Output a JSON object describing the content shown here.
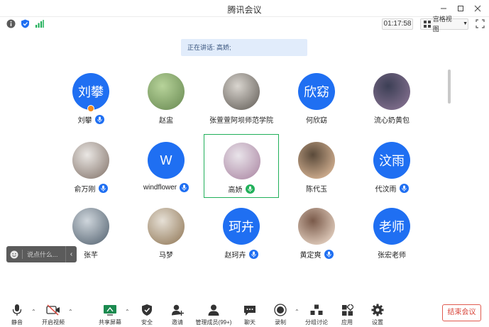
{
  "window": {
    "title": "腾讯会议"
  },
  "infobar": {
    "timer": "01:17:58",
    "view_mode": "宫格视图"
  },
  "speaking": {
    "text": "正在讲话: 高娇;"
  },
  "participants": [
    {
      "name": "刘攀",
      "avatar_text": "刘攀",
      "type": "text",
      "mic": "on",
      "host": true
    },
    {
      "name": "赵盅",
      "avatar_text": "",
      "type": "photo",
      "mic": "none",
      "host": false
    },
    {
      "name": "张萱萱阿坝师范学院",
      "avatar_text": "",
      "type": "photo",
      "mic": "none",
      "host": false
    },
    {
      "name": "何欣窈",
      "avatar_text": "欣窈",
      "type": "text",
      "mic": "none",
      "host": false
    },
    {
      "name": "流心奶黄包",
      "avatar_text": "",
      "type": "photo",
      "mic": "none",
      "host": false
    },
    {
      "name": "俞万刚",
      "avatar_text": "",
      "type": "photo",
      "mic": "on",
      "host": false
    },
    {
      "name": "windflower",
      "avatar_text": "W",
      "type": "text",
      "mic": "on",
      "host": false
    },
    {
      "name": "高娇",
      "avatar_text": "",
      "type": "photo",
      "mic": "speaking",
      "host": false
    },
    {
      "name": "陈代玉",
      "avatar_text": "",
      "type": "photo",
      "mic": "none",
      "host": false
    },
    {
      "name": "代汶雨",
      "avatar_text": "汶雨",
      "type": "text",
      "mic": "on",
      "host": false
    },
    {
      "name": "张芊",
      "avatar_text": "",
      "type": "photo",
      "mic": "none",
      "host": false
    },
    {
      "name": "马梦",
      "avatar_text": "",
      "type": "photo",
      "mic": "none",
      "host": false
    },
    {
      "name": "赵珂卉",
      "avatar_text": "珂卉",
      "type": "text",
      "mic": "on",
      "host": false
    },
    {
      "name": "黄定爽",
      "avatar_text": "",
      "type": "photo",
      "mic": "on",
      "host": false
    },
    {
      "name": "张宏老师",
      "avatar_text": "老师",
      "type": "text",
      "mic": "none",
      "host": false
    }
  ],
  "chat": {
    "placeholder": "说点什么..."
  },
  "toolbar": {
    "mute": "静音",
    "video": "开启视频",
    "share": "共享屏幕",
    "security": "安全",
    "invite": "邀请",
    "members": "管理成员(99+)",
    "chat": "聊天",
    "record": "录制",
    "breakout": "分组讨论",
    "apps": "应用",
    "settings": "设置",
    "end": "结束会议"
  },
  "colors": {
    "accent": "#1f6ff2",
    "speaking": "#21b05a",
    "end": "#d9473c"
  }
}
